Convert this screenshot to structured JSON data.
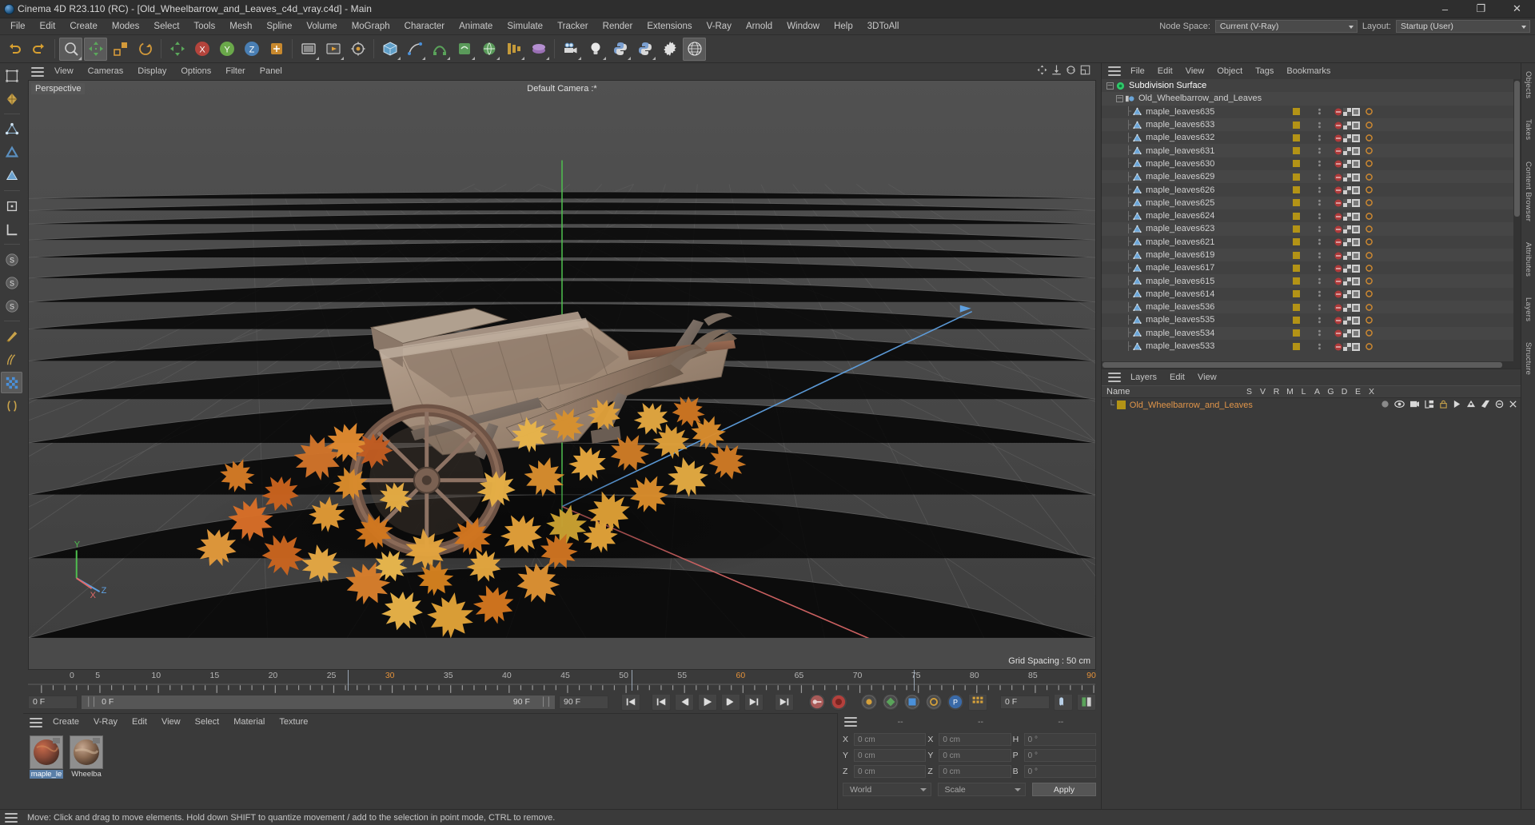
{
  "window": {
    "title": "Cinema 4D R23.110 (RC) - [Old_Wheelbarrow_and_Leaves_c4d_vray.c4d] - Main",
    "minimize": "–",
    "maximize": "❐",
    "close": "✕"
  },
  "menubar": {
    "items": [
      "File",
      "Edit",
      "Create",
      "Modes",
      "Select",
      "Tools",
      "Mesh",
      "Spline",
      "Volume",
      "MoGraph",
      "Character",
      "Animate",
      "Simulate",
      "Tracker",
      "Render",
      "Extensions",
      "V-Ray",
      "Arnold",
      "Window",
      "Help",
      "3DToAll"
    ],
    "node_space_label": "Node Space:",
    "node_space_value": "Current (V-Ray)",
    "layout_label": "Layout:",
    "layout_value": "Startup (User)"
  },
  "viewport": {
    "menu": [
      "View",
      "Cameras",
      "Display",
      "Options",
      "Filter",
      "Panel"
    ],
    "label": "Perspective",
    "camera": "Default Camera :*",
    "grid_spacing": "Grid Spacing : 50 cm",
    "axis_x": "X",
    "axis_y": "Y",
    "axis_z": "Z"
  },
  "timeline": {
    "ticks": [
      {
        "label": "0",
        "pos": 0
      },
      {
        "label": "5",
        "pos": 5
      },
      {
        "label": "10",
        "pos": 10
      },
      {
        "label": "15",
        "pos": 15
      },
      {
        "label": "20",
        "pos": 20
      },
      {
        "label": "25",
        "pos": 25
      },
      {
        "label": "30",
        "pos": 30
      },
      {
        "label": "35",
        "pos": 35
      },
      {
        "label": "40",
        "pos": 40
      },
      {
        "label": "45",
        "pos": 45
      },
      {
        "label": "50",
        "pos": 50
      },
      {
        "label": "55",
        "pos": 55
      },
      {
        "label": "60",
        "pos": 60
      },
      {
        "label": "65",
        "pos": 65
      },
      {
        "label": "70",
        "pos": 70
      },
      {
        "label": "75",
        "pos": 75
      },
      {
        "label": "80",
        "pos": 80
      },
      {
        "label": "85",
        "pos": 85
      },
      {
        "label": "90",
        "pos": 90
      }
    ],
    "highlighted_ticks": [
      "30",
      "60",
      "90"
    ],
    "current_frame": "0 F",
    "current_frame_strip": "0 F",
    "end_frame_left": "90 F",
    "end_frame_field": "90 F",
    "preview_frame": "0 F"
  },
  "materials": {
    "menu": [
      "Create",
      "V-Ray",
      "Edit",
      "View",
      "Select",
      "Material",
      "Texture"
    ],
    "items": [
      {
        "name": "maple_le",
        "selected": true
      },
      {
        "name": "Wheelba",
        "selected": false
      }
    ]
  },
  "coordinates": {
    "headers": [
      "--",
      "--",
      "--"
    ],
    "rows": [
      {
        "label1": "X",
        "value1": "0 cm",
        "label2": "X",
        "value2": "0 cm",
        "label3": "H",
        "value3": "0 °"
      },
      {
        "label1": "Y",
        "value1": "0 cm",
        "label2": "Y",
        "value2": "0 cm",
        "label3": "P",
        "value3": "0 °"
      },
      {
        "label1": "Z",
        "value1": "0 cm",
        "label2": "Z",
        "value2": "0 cm",
        "label3": "B",
        "value3": "0 °"
      }
    ],
    "space": "World",
    "mode": "Scale",
    "apply": "Apply"
  },
  "object_manager": {
    "menu": [
      "File",
      "Edit",
      "View",
      "Object",
      "Tags",
      "Bookmarks"
    ],
    "rows": [
      {
        "name": "Subdivision Surface",
        "depth": 0,
        "icon": "subdivision-surface-icon",
        "expander": true,
        "selected": true,
        "tags": false
      },
      {
        "name": "Old_Wheelbarrow_and_Leaves",
        "depth": 1,
        "icon": "null-object-icon",
        "expander": true,
        "selected": false,
        "tags": false
      },
      {
        "name": "maple_leaves635",
        "depth": 2,
        "icon": "polygon-object-icon",
        "expander": false,
        "selected": false,
        "tags": true
      },
      {
        "name": "maple_leaves633",
        "depth": 2,
        "icon": "polygon-object-icon",
        "expander": false,
        "selected": false,
        "tags": true
      },
      {
        "name": "maple_leaves632",
        "depth": 2,
        "icon": "polygon-object-icon",
        "expander": false,
        "selected": false,
        "tags": true
      },
      {
        "name": "maple_leaves631",
        "depth": 2,
        "icon": "polygon-object-icon",
        "expander": false,
        "selected": false,
        "tags": true
      },
      {
        "name": "maple_leaves630",
        "depth": 2,
        "icon": "polygon-object-icon",
        "expander": false,
        "selected": false,
        "tags": true
      },
      {
        "name": "maple_leaves629",
        "depth": 2,
        "icon": "polygon-object-icon",
        "expander": false,
        "selected": false,
        "tags": true
      },
      {
        "name": "maple_leaves626",
        "depth": 2,
        "icon": "polygon-object-icon",
        "expander": false,
        "selected": false,
        "tags": true
      },
      {
        "name": "maple_leaves625",
        "depth": 2,
        "icon": "polygon-object-icon",
        "expander": false,
        "selected": false,
        "tags": true
      },
      {
        "name": "maple_leaves624",
        "depth": 2,
        "icon": "polygon-object-icon",
        "expander": false,
        "selected": false,
        "tags": true
      },
      {
        "name": "maple_leaves623",
        "depth": 2,
        "icon": "polygon-object-icon",
        "expander": false,
        "selected": false,
        "tags": true
      },
      {
        "name": "maple_leaves621",
        "depth": 2,
        "icon": "polygon-object-icon",
        "expander": false,
        "selected": false,
        "tags": true
      },
      {
        "name": "maple_leaves619",
        "depth": 2,
        "icon": "polygon-object-icon",
        "expander": false,
        "selected": false,
        "tags": true
      },
      {
        "name": "maple_leaves617",
        "depth": 2,
        "icon": "polygon-object-icon",
        "expander": false,
        "selected": false,
        "tags": true
      },
      {
        "name": "maple_leaves615",
        "depth": 2,
        "icon": "polygon-object-icon",
        "expander": false,
        "selected": false,
        "tags": true
      },
      {
        "name": "maple_leaves614",
        "depth": 2,
        "icon": "polygon-object-icon",
        "expander": false,
        "selected": false,
        "tags": true
      },
      {
        "name": "maple_leaves536",
        "depth": 2,
        "icon": "polygon-object-icon",
        "expander": false,
        "selected": false,
        "tags": true
      },
      {
        "name": "maple_leaves535",
        "depth": 2,
        "icon": "polygon-object-icon",
        "expander": false,
        "selected": false,
        "tags": true
      },
      {
        "name": "maple_leaves534",
        "depth": 2,
        "icon": "polygon-object-icon",
        "expander": false,
        "selected": false,
        "tags": true
      },
      {
        "name": "maple_leaves533",
        "depth": 2,
        "icon": "polygon-object-icon",
        "expander": false,
        "selected": false,
        "tags": true
      }
    ]
  },
  "layers": {
    "menu": [
      "Layers",
      "Edit",
      "View"
    ],
    "name_header": "Name",
    "columns": [
      "S",
      "V",
      "R",
      "M",
      "L",
      "A",
      "G",
      "D",
      "E",
      "X"
    ],
    "rows": [
      {
        "name": "Old_Wheelbarrow_and_Leaves",
        "color": "#b39316"
      }
    ]
  },
  "right_tabs": [
    "Objects",
    "Takes",
    "Content Browser",
    "Attributes",
    "Layers",
    "Structure"
  ],
  "statusbar": {
    "message": "Move: Click and drag to move elements. Hold down SHIFT to quantize movement / add to the selection in point mode, CTRL to remove."
  },
  "colors": {
    "accent_orange": "#e0954a",
    "layer_yellow": "#b39316",
    "axis_x": "#c4564f",
    "axis_y": "#5fbf5f",
    "axis_z": "#5a8fc4",
    "selection_blue": "#5a7fa8",
    "panel_bg": "#3a3a3a",
    "list_bg": "#414141"
  }
}
